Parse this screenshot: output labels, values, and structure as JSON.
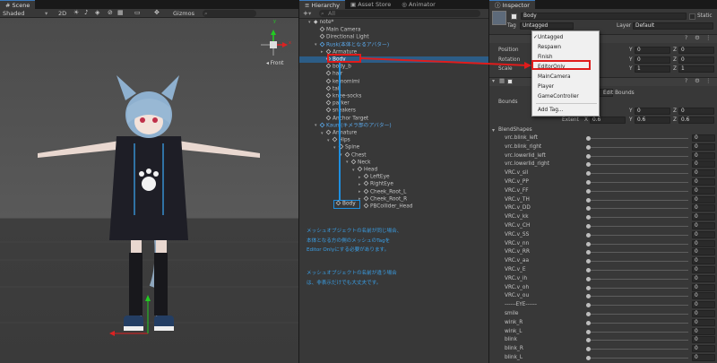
{
  "scene": {
    "tab_label": "Scene",
    "toolbar": {
      "shading": "Shaded",
      "mode": "2D",
      "gizmos": "Gizmos",
      "search_placeholder": "All"
    },
    "gizmo": {
      "persp_label": "Front",
      "axis_y": "y",
      "axis_x": "x"
    }
  },
  "hierarchy": {
    "tabs": [
      "Hierarchy",
      "Asset Store",
      "Animator"
    ],
    "add": "+",
    "search_placeholder": "All",
    "rows": [
      {
        "label": "note*",
        "indent": 0,
        "caret": "▾",
        "cube": false,
        "style": "scene"
      },
      {
        "label": "Main Camera",
        "indent": 1,
        "caret": "",
        "cube": true,
        "style": ""
      },
      {
        "label": "Directional Light",
        "indent": 1,
        "caret": "",
        "cube": true,
        "style": ""
      },
      {
        "label": "Rusk(本体となるアバター)",
        "indent": 1,
        "caret": "▾",
        "cube": true,
        "style": "blue"
      },
      {
        "label": "Armature",
        "indent": 2,
        "caret": "▸",
        "cube": true,
        "style": ""
      },
      {
        "label": "Body",
        "indent": 2,
        "caret": "",
        "cube": true,
        "style": "sel"
      },
      {
        "label": "body_b",
        "indent": 2,
        "caret": "",
        "cube": true,
        "style": ""
      },
      {
        "label": "hair",
        "indent": 2,
        "caret": "",
        "cube": true,
        "style": ""
      },
      {
        "label": "kemomimi",
        "indent": 2,
        "caret": "",
        "cube": true,
        "style": ""
      },
      {
        "label": "tail",
        "indent": 2,
        "caret": "",
        "cube": true,
        "style": ""
      },
      {
        "label": "knee-socks",
        "indent": 2,
        "caret": "",
        "cube": true,
        "style": ""
      },
      {
        "label": "parker",
        "indent": 2,
        "caret": "",
        "cube": true,
        "style": ""
      },
      {
        "label": "sneakers",
        "indent": 2,
        "caret": "",
        "cube": true,
        "style": ""
      },
      {
        "label": "Anchor Target",
        "indent": 2,
        "caret": "",
        "cube": true,
        "style": ""
      },
      {
        "label": "Kaunl(キメラ部のアバター)",
        "indent": 1,
        "caret": "▾",
        "cube": true,
        "style": "blue"
      },
      {
        "label": "Armature",
        "indent": 2,
        "caret": "▾",
        "cube": true,
        "style": ""
      },
      {
        "label": "Hips",
        "indent": 3,
        "caret": "▾",
        "cube": true,
        "style": ""
      },
      {
        "label": "Spine",
        "indent": 4,
        "caret": "▾",
        "cube": true,
        "style": ""
      },
      {
        "label": "Chest",
        "indent": 5,
        "caret": "▾",
        "cube": true,
        "style": ""
      },
      {
        "label": "Neck",
        "indent": 6,
        "caret": "▾",
        "cube": true,
        "style": ""
      },
      {
        "label": "Head",
        "indent": 7,
        "caret": "▾",
        "cube": true,
        "style": ""
      },
      {
        "label": "LeftEye",
        "indent": 8,
        "caret": "▸",
        "cube": true,
        "style": ""
      },
      {
        "label": "RightEye",
        "indent": 8,
        "caret": "▸",
        "cube": true,
        "style": ""
      },
      {
        "label": "Cheek_Root_L",
        "indent": 8,
        "caret": "▸",
        "cube": true,
        "style": ""
      },
      {
        "label": "Cheek_Root_R",
        "indent": 8,
        "caret": "▸",
        "cube": true,
        "style": ""
      },
      {
        "label": "PBCollider_Head",
        "indent": 8,
        "caret": "",
        "cube": true,
        "style": ""
      }
    ],
    "body_callout": "Body",
    "note_lines_1": [
      "メッシュオブジェクトの名前が同じ場合、",
      "本体となる方の側のメッシュのTagを",
      "Editor Onlyにする必要があります。"
    ],
    "note_lines_2": [
      "メッシュオブジェクトの名前が違う場合",
      "は、非表示だけでも大丈夫です。"
    ]
  },
  "inspector": {
    "tab_label": "Inspector",
    "object_name": "Body",
    "static_label": "Static",
    "tag_label": "Tag",
    "tag_value": "Untagged",
    "layer_label": "Layer",
    "layer_value": "Default",
    "transform": {
      "position_label": "Position",
      "rotation_label": "Rotation",
      "scale_label": "Scale",
      "position": {
        "y": "0",
        "z": "0"
      },
      "rotation": {
        "y": "0",
        "z": "0"
      },
      "scale": {
        "y": "1",
        "z": "1"
      }
    },
    "skinned": {
      "edit_bounds": "Edit Bounds",
      "bounds_label": "Bounds",
      "center": {
        "y": "0",
        "z": "0"
      },
      "extent_label": "Extent",
      "extent": {
        "x": "0.6",
        "y": "0.6",
        "z": "0.6"
      }
    },
    "blendshapes_label": "BlendShapes",
    "blendshapes": [
      "vrc.blink_left",
      "vrc.blink_right",
      "vrc.lowerlid_left",
      "vrc.lowerlid_right",
      "VRC.v_sil",
      "VRC.v_PP",
      "VRC.v_FF",
      "VRC.v_TH",
      "VRC.v_DD",
      "VRC.v_kk",
      "VRC.v_CH",
      "VRC.v_SS",
      "VRC.v_nn",
      "VRC.v_RR",
      "VRC.v_aa",
      "VRC.v_E",
      "VRC.v_ih",
      "VRC.v_oh",
      "VRC.v_ou",
      "------EYE------",
      "smile",
      "wink_R",
      "wink_L",
      "blink",
      "blink_R",
      "blink_L"
    ],
    "blend_value": "0",
    "tag_menu": [
      "Untagged",
      "Respawn",
      "Finish",
      "EditorOnly",
      "MainCamera",
      "Player",
      "GameController",
      "Add Tag..."
    ],
    "tag_menu_checked": "Untagged",
    "tag_menu_highlight": "EditorOnly"
  },
  "colors": {
    "highlight_red": "#e01c1c",
    "selection_blue": "#2c5d87",
    "note_blue": "#3aa0e8"
  }
}
